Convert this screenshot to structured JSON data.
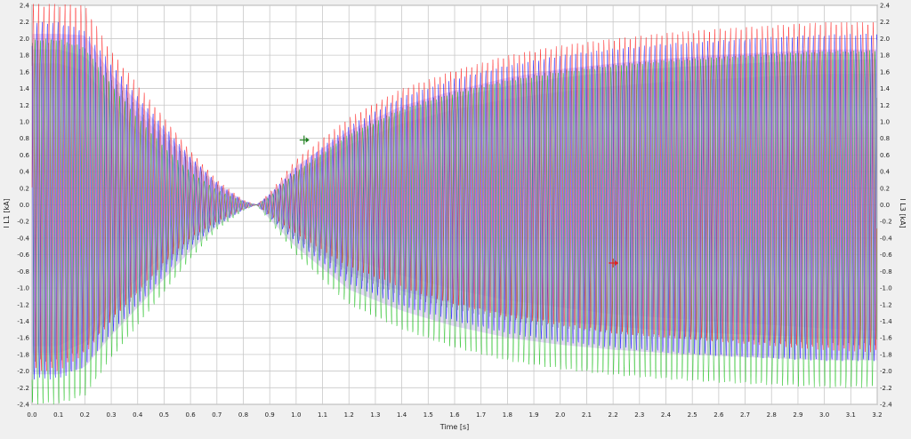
{
  "chart_data": {
    "type": "line",
    "xlabel": "Time [s]",
    "ylabel_left": "I L1 [kA]",
    "ylabel_right": "I L3 [kA]",
    "xlim": [
      0.0,
      3.2
    ],
    "ylim": [
      -2.4,
      2.4
    ],
    "x_ticks": [
      "0.0",
      "0.1",
      "0.2",
      "0.3",
      "0.4",
      "0.5",
      "0.6",
      "0.7",
      "0.8",
      "0.9",
      "1.0",
      "1.1",
      "1.2",
      "1.3",
      "1.4",
      "1.5",
      "1.6",
      "1.7",
      "1.8",
      "1.9",
      "2.0",
      "2.1",
      "2.2",
      "2.3",
      "2.4",
      "2.5",
      "2.6",
      "2.7",
      "2.8",
      "2.9",
      "3.0",
      "3.1",
      "3.2"
    ],
    "y_ticks": [
      "2.4",
      "2.2",
      "2.0",
      "1.8",
      "1.6",
      "1.4",
      "1.2",
      "1.0",
      "0.8",
      "0.6",
      "0.4",
      "0.2",
      "0.0",
      "-0.2",
      "-0.4",
      "-0.6",
      "-0.8",
      "-1.0",
      "-1.2",
      "-1.4",
      "-1.6",
      "-1.8",
      "-2.0",
      "-2.2",
      "-2.4"
    ],
    "grid": true,
    "series": [
      {
        "color": "#ff2020",
        "x": [
          0.0,
          0.1,
          0.2,
          0.3,
          0.4,
          0.5,
          0.6,
          0.7,
          0.8,
          0.85,
          0.9,
          1.0,
          1.2,
          1.4,
          1.6,
          1.8,
          2.0,
          2.2,
          2.4,
          2.6,
          2.8,
          3.0,
          3.2
        ],
        "upper": [
          2.42,
          2.42,
          2.4,
          1.85,
          1.45,
          1.05,
          0.65,
          0.3,
          0.06,
          0.0,
          0.15,
          0.55,
          1.05,
          1.4,
          1.62,
          1.8,
          1.92,
          2.0,
          2.07,
          2.12,
          2.16,
          2.2,
          2.2
        ],
        "lower": [
          -2.0,
          -2.0,
          -1.8,
          -1.4,
          -1.05,
          -0.7,
          -0.4,
          -0.2,
          -0.05,
          0.0,
          -0.12,
          -0.35,
          -0.75,
          -1.0,
          -1.2,
          -1.35,
          -1.45,
          -1.55,
          -1.6,
          -1.65,
          -1.7,
          -1.75,
          -1.78
        ]
      },
      {
        "color": "#2020ff",
        "x": [
          0.0,
          0.1,
          0.2,
          0.3,
          0.4,
          0.5,
          0.6,
          0.7,
          0.8,
          0.85,
          0.9,
          1.0,
          1.2,
          1.4,
          1.6,
          1.8,
          2.0,
          2.2,
          2.4,
          2.6,
          2.8,
          3.0,
          3.2
        ],
        "upper": [
          2.2,
          2.2,
          2.1,
          1.7,
          1.3,
          0.95,
          0.58,
          0.27,
          0.05,
          0.0,
          0.13,
          0.45,
          0.95,
          1.3,
          1.52,
          1.68,
          1.8,
          1.88,
          1.94,
          1.98,
          2.02,
          2.05,
          2.06
        ],
        "lower": [
          -2.1,
          -2.1,
          -1.95,
          -1.55,
          -1.2,
          -0.85,
          -0.5,
          -0.25,
          -0.06,
          0.0,
          -0.15,
          -0.45,
          -0.95,
          -1.22,
          -1.4,
          -1.55,
          -1.65,
          -1.72,
          -1.78,
          -1.82,
          -1.85,
          -1.88,
          -1.88
        ]
      },
      {
        "color": "#20c020",
        "x": [
          0.0,
          0.1,
          0.2,
          0.3,
          0.4,
          0.5,
          0.6,
          0.7,
          0.8,
          0.85,
          0.9,
          1.0,
          1.2,
          1.4,
          1.6,
          1.8,
          2.0,
          2.2,
          2.4,
          2.6,
          2.8,
          3.0,
          3.2
        ],
        "upper": [
          2.0,
          2.0,
          1.9,
          1.45,
          1.05,
          0.7,
          0.4,
          0.18,
          0.04,
          0.0,
          0.1,
          0.4,
          0.85,
          1.15,
          1.35,
          1.5,
          1.6,
          1.68,
          1.74,
          1.78,
          1.82,
          1.85,
          1.86
        ],
        "lower": [
          -2.4,
          -2.4,
          -2.3,
          -1.85,
          -1.45,
          -1.05,
          -0.65,
          -0.3,
          -0.07,
          0.0,
          -0.2,
          -0.6,
          -1.2,
          -1.5,
          -1.72,
          -1.88,
          -1.98,
          -2.05,
          -2.1,
          -2.14,
          -2.17,
          -2.2,
          -2.2
        ]
      }
    ],
    "markers": [
      {
        "x": 1.03,
        "y": 0.78,
        "color": "#208020"
      },
      {
        "x": 2.2,
        "y": -0.7,
        "color": "#e02020"
      }
    ]
  }
}
